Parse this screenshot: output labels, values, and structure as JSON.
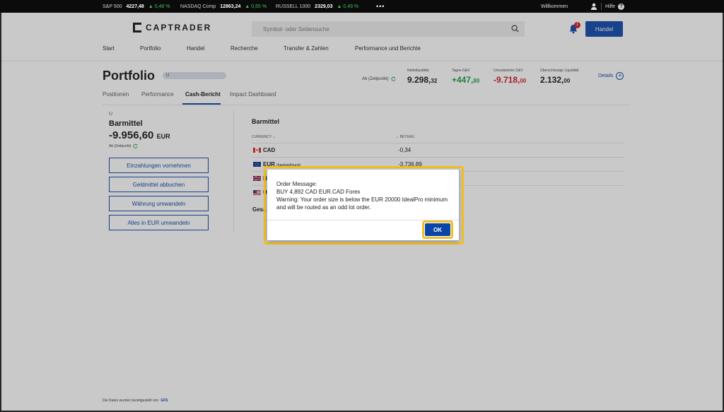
{
  "ticker": {
    "items": [
      {
        "name": "S&P 500",
        "value": "4227,48",
        "change": "▲ 0,48 %"
      },
      {
        "name": "NASDAQ Comp",
        "value": "12863,24",
        "change": "▲ 0,65 %"
      },
      {
        "name": "RUSSELL 1000",
        "value": "2329,03",
        "change": "▲ 0,49 %"
      }
    ],
    "more": "•••",
    "welcome": "Willkommen",
    "help": "Hilfe",
    "help_icon": "?"
  },
  "header": {
    "logo": "CAPTRADER",
    "search_placeholder": "Symbol- oder Seitensuche",
    "notifications": "1",
    "trade_button": "Handel"
  },
  "nav": [
    "Start",
    "Portfolio",
    "Handel",
    "Recherche",
    "Transfer & Zahlen",
    "Performance und Berichte"
  ],
  "portfolio": {
    "title": "Portfolio",
    "account": "U",
    "as_of": "Ab (Zeitpunkt)",
    "metrics": [
      {
        "label": "Nettoliquidität",
        "main": "9.298,",
        "dec": "32",
        "color": "#111111"
      },
      {
        "label": "Tages-G&V",
        "main": "+447,",
        "dec": "80",
        "color": "#1a9c3e"
      },
      {
        "label": "Unrealisierter G&V",
        "main": "-9.718,",
        "dec": "00",
        "color": "#d3141c"
      },
      {
        "label": "Überschüssige Liquidität",
        "main": "2.132,",
        "dec": "00",
        "color": "#111111"
      }
    ],
    "details": "Details",
    "details_icon": "+",
    "tabs": [
      "Positionen",
      "Performance",
      "Cash-Bericht",
      "Impact Dashboard"
    ]
  },
  "cash": {
    "account": "U",
    "title": "Barmittel",
    "amount": "-9.956,60",
    "currency": "EUR",
    "as_of": "Ab (Zeitpunkt)",
    "buttons": [
      "Einzahlungen vornehmen",
      "Geldmittel abbuchen",
      "Währung umwandeln",
      "Alles in EUR umwandeln"
    ]
  },
  "table": {
    "title": "Barmittel",
    "col_currency": "CURRENCY ⌄",
    "col_amount": "⌄ BETRAG",
    "rows": [
      {
        "ccy": "CAD",
        "note": "",
        "amount": "-0,34"
      },
      {
        "ccy": "EUR",
        "note": "(basiswährung)",
        "amount": "-3.736,89"
      },
      {
        "ccy": "N",
        "note": "",
        "amount": ""
      },
      {
        "ccy": "U",
        "note": "",
        "amount": ""
      }
    ],
    "total_label": "Gesa"
  },
  "footer": {
    "text": "Die Daten wurden bereitgestellt von",
    "provider": "GFS"
  },
  "dialog": {
    "lines": [
      "Order Message:",
      "BUY 4,892 CAD EUR.CAD Forex",
      "Warning: Your order size is below the EUR 20000 IdealPro minimum and will be routed as an odd lot order."
    ],
    "ok": "OK"
  }
}
